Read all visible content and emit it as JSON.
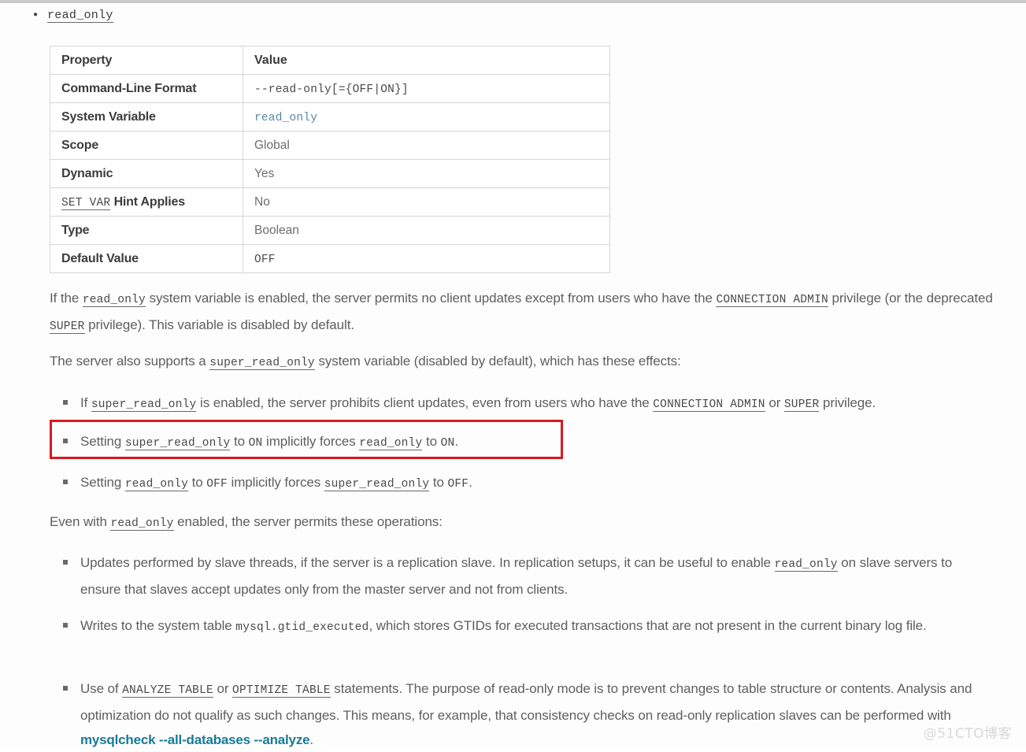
{
  "doc": {
    "heading_item": "read_only",
    "watermark": "@51CTO博客"
  },
  "table": {
    "header": {
      "property": "Property",
      "value": "Value"
    },
    "rows": [
      {
        "key": "Command-Line Format",
        "value": "--read-only[={OFF|ON}]",
        "value_style": "mono"
      },
      {
        "key": "System Variable",
        "value": "read_only",
        "value_style": "mono-blue"
      },
      {
        "key": "Scope",
        "value": "Global",
        "value_style": "plain"
      },
      {
        "key": "Dynamic",
        "value": "Yes",
        "value_style": "plain"
      },
      {
        "key": "SET VAR",
        "key_suffix": "Hint Applies",
        "value": "No",
        "value_style": "plain"
      },
      {
        "key": "Type",
        "value": "Boolean",
        "value_style": "plain"
      },
      {
        "key": "Default Value",
        "value": "OFF",
        "value_style": "mono"
      }
    ]
  },
  "paragraphs": {
    "p1": {
      "a": "If the ",
      "code1": "read_only",
      "b": " system variable is enabled, the server permits no client updates except from users who have the ",
      "code2": "CONNECTION ADMIN",
      "c": " privilege (or the deprecated ",
      "code3": "SUPER",
      "d": " privilege). This variable is disabled by default."
    },
    "p2": {
      "a": "The server also supports a ",
      "code1": "super_read_only",
      "b": " system variable (disabled by default), which has these effects:"
    },
    "p3": {
      "a": "Even with ",
      "code1": "read_only",
      "b": " enabled, the server permits these operations:"
    }
  },
  "bullets": {
    "b1": {
      "a": "If ",
      "code1": "super_read_only",
      "b": " is enabled, the server prohibits client updates, even from users who have the ",
      "code2": "CONNECTION ADMIN",
      "c": " or ",
      "code3": "SUPER",
      "d": " privilege."
    },
    "b2": {
      "a": "Setting ",
      "code1": "super_read_only",
      "b": " to ",
      "code2": "ON",
      "c": " implicitly forces ",
      "code3": "read_only",
      "d": " to ",
      "code4": "ON",
      "e": "."
    },
    "b3": {
      "a": "Setting ",
      "code1": "read_only",
      "b": " to ",
      "code2": "OFF",
      "c": " implicitly forces ",
      "code3": "super_read_only",
      "d": " to ",
      "code4": "OFF",
      "e": "."
    },
    "b4": {
      "a": "Updates performed by slave threads, if the server is a replication slave. In replication setups, it can be useful to enable ",
      "code1": "read_only",
      "b": " on slave servers to ensure that slaves accept updates only from the master server and not from clients."
    },
    "b5": {
      "a": "Writes to the system table ",
      "code1": "mysql.gtid_executed",
      "b": ", which stores GTIDs for executed transactions that are not present in the current binary log file."
    },
    "b6": {
      "a": "Use of ",
      "code1": "ANALYZE TABLE",
      "b": " or ",
      "code2": "OPTIMIZE TABLE",
      "c": " statements. The purpose of read-only mode is to prevent changes to table structure or contents. Analysis and optimization do not qualify as such changes. This means, for example, that consistency checks on read-only replication slaves can be performed with ",
      "cmd": "mysqlcheck --all-databases --analyze",
      "d": "."
    }
  },
  "colors": {
    "highlight_border": "#d9181f",
    "link_blue": "#5a87a8",
    "command_teal": "#1a7a96",
    "body_text": "#5f5f5f"
  }
}
